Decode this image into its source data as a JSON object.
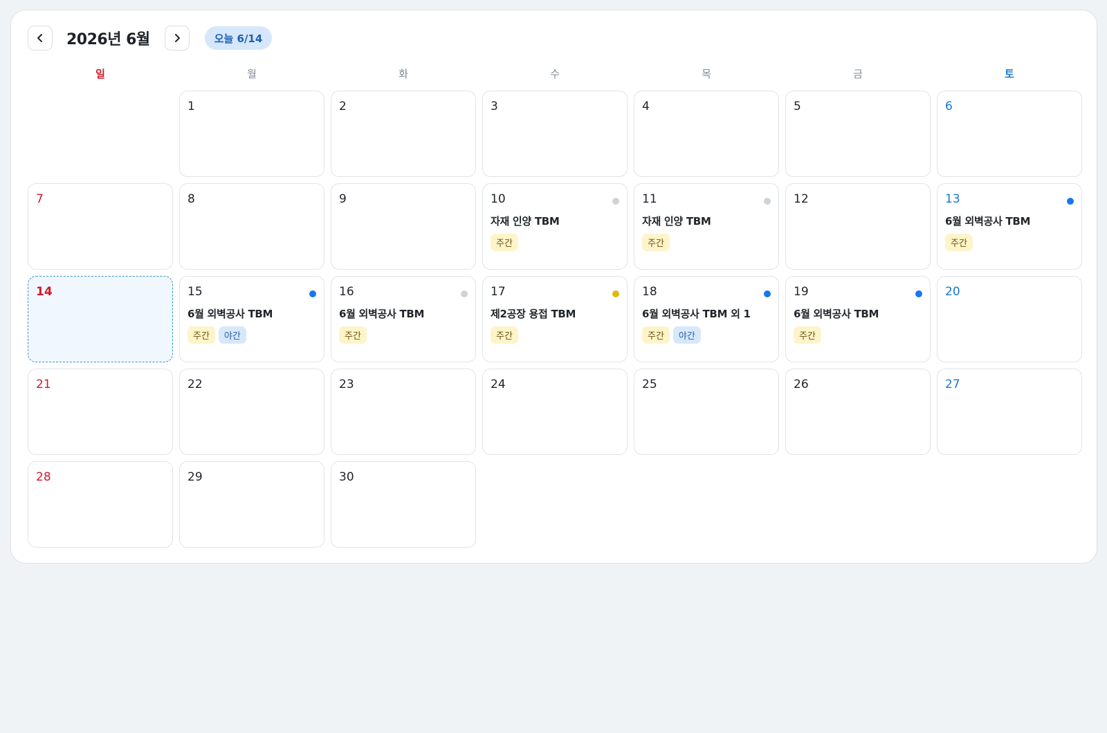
{
  "calendar": {
    "title": "2026년 6월",
    "today_label": "오늘 6/14",
    "weekdays": [
      "일",
      "월",
      "화",
      "수",
      "목",
      "금",
      "토"
    ],
    "colors": {
      "sunday": "#d11a2a",
      "saturday": "#1677d2",
      "dot_blue": "#1677ee",
      "dot_gray": "#cfd3d8",
      "dot_yellow": "#e2b80e",
      "today_border": "#3793c8"
    },
    "start_weekday": 1,
    "days": [
      {
        "day": "1"
      },
      {
        "day": "2"
      },
      {
        "day": "3"
      },
      {
        "day": "4"
      },
      {
        "day": "5"
      },
      {
        "day": "6"
      },
      {
        "day": "7"
      },
      {
        "day": "8"
      },
      {
        "day": "9"
      },
      {
        "day": "10",
        "dot": "gray",
        "event": "자재 인양 TBM",
        "tags": [
          "주간"
        ]
      },
      {
        "day": "11",
        "dot": "gray",
        "event": "자재 인양 TBM",
        "tags": [
          "주간"
        ]
      },
      {
        "day": "12"
      },
      {
        "day": "13",
        "dot": "blue",
        "event": "6월 외벽공사 TBM",
        "tags": [
          "주간"
        ]
      },
      {
        "day": "14",
        "today": true
      },
      {
        "day": "15",
        "dot": "blue",
        "event": "6월 외벽공사 TBM",
        "tags": [
          "주간",
          "야간"
        ]
      },
      {
        "day": "16",
        "dot": "gray",
        "event": "6월 외벽공사 TBM",
        "tags": [
          "주간"
        ]
      },
      {
        "day": "17",
        "dot": "yellow",
        "event": "제2공장 용접 TBM",
        "tags": [
          "주간"
        ]
      },
      {
        "day": "18",
        "dot": "blue",
        "event": "6월 외벽공사 TBM 외 1",
        "tags": [
          "주간",
          "야간"
        ]
      },
      {
        "day": "19",
        "dot": "blue",
        "event": "6월 외벽공사 TBM",
        "tags": [
          "주간"
        ]
      },
      {
        "day": "20"
      },
      {
        "day": "21"
      },
      {
        "day": "22"
      },
      {
        "day": "23"
      },
      {
        "day": "24"
      },
      {
        "day": "25"
      },
      {
        "day": "26"
      },
      {
        "day": "27"
      },
      {
        "day": "28"
      },
      {
        "day": "29"
      },
      {
        "day": "30"
      }
    ]
  }
}
